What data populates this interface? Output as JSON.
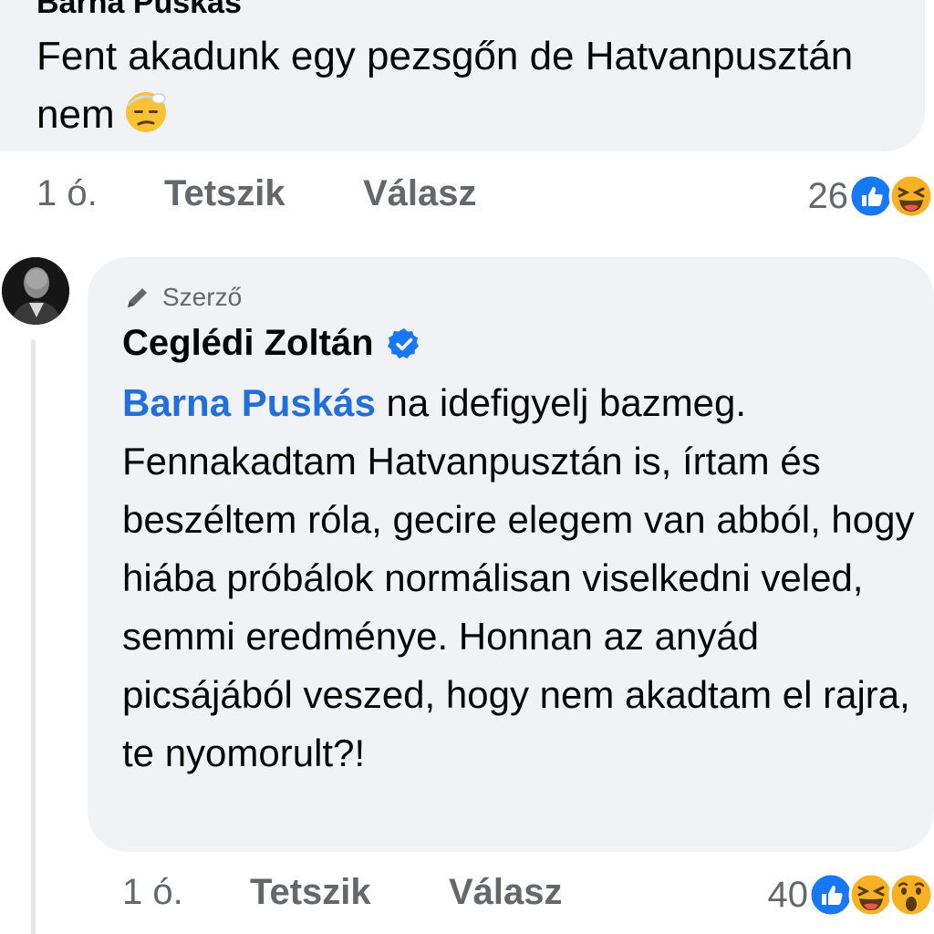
{
  "comment1": {
    "author_partial": "Barna Puskás",
    "text": "Fent akadunk egy pezsgőn de Hatvanpusztán nem",
    "emoji": "dizzy-bandaged-face-emoji",
    "time": "1 ó.",
    "like_label": "Tetszik",
    "reply_label": "Válasz",
    "reaction_count": "26",
    "reactions": [
      "like-icon",
      "haha-icon"
    ]
  },
  "reply": {
    "badge": "Szerző",
    "badge_icon": "pencil-icon",
    "author": "Ceglédi Zoltán",
    "verified": true,
    "mention": "Barna Puskás",
    "text": " na idefigyelj bazmeg. Fennakadtam Hatvanpusztán is, írtam és beszéltem róla, gecire elegem van abból, hogy hiába próbálok normálisan viselkedni veled, semmi eredménye. Honnan az anyád picsájából veszed, hogy nem akadtam el rajra, te nyomorult?!",
    "time": "1 ó.",
    "like_label": "Tetszik",
    "reply_label": "Válasz",
    "reaction_count": "40",
    "reactions": [
      "like-icon",
      "haha-icon",
      "wow-icon"
    ]
  },
  "colors": {
    "bubble": "#f0f2f5",
    "mention": "#216fdb",
    "meta": "#65676b",
    "like_blue": "#1877f2"
  }
}
